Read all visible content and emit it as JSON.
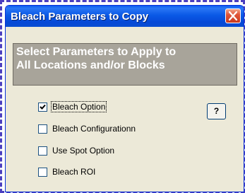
{
  "dialog": {
    "title": "Bleach Parameters to Copy",
    "header_line1": "Select Parameters to Apply to",
    "header_line2": "All Locations and/or Blocks",
    "help_label": "?",
    "options": [
      {
        "label": "Bleach Option",
        "checked": true
      },
      {
        "label": "Bleach Configurationn",
        "checked": false
      },
      {
        "label": "Use Spot Option",
        "checked": false
      },
      {
        "label": "Bleach ROI",
        "checked": false
      }
    ]
  },
  "colors": {
    "titlebar": "#0a59e6",
    "dialog_bg": "#ece9d8",
    "header_panel": "#a8a49a",
    "frame_border": "#4b3fbf",
    "close_button": "#e0553a"
  },
  "icons": {
    "close": "close-icon",
    "check": "checkmark-icon"
  }
}
